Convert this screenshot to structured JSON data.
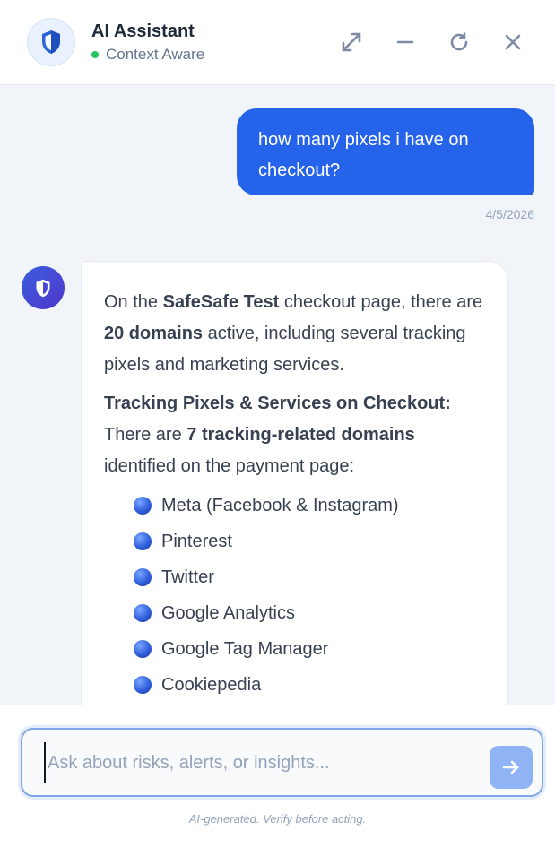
{
  "header": {
    "title": "AI Assistant",
    "status": "Context Aware",
    "status_color": "#22c55e",
    "icons": [
      "shield-icon",
      "expand-icon",
      "minimize-icon",
      "refresh-icon",
      "close-icon"
    ]
  },
  "messages": {
    "user": {
      "text": "how many pixels i have on checkout?",
      "timestamp": "4/5/2026"
    },
    "assistant": {
      "p1_a": "On the ",
      "p1_store": "SafeSafe Test",
      "p1_b": " checkout page, there are ",
      "p1_count": "20 domains",
      "p1_c": " active, including several tracking pixels and marketing services.",
      "p2_heading": "Tracking Pixels & Services on Checkout:",
      "p2_a": "There are ",
      "p2_count": "7 tracking-related domains",
      "p2_b": " identified on the payment page:",
      "items": [
        "Meta (Facebook & Instagram)",
        "Pinterest",
        "Twitter",
        "Google Analytics",
        "Google Tag Manager",
        "Cookiepedia"
      ]
    }
  },
  "composer": {
    "placeholder": "Ask about risks, alerts, or insights...",
    "value": "",
    "disclaimer": "AI-generated. Verify before acting."
  },
  "colors": {
    "accent": "#2563eb",
    "send_button": "#8fb3f5"
  }
}
